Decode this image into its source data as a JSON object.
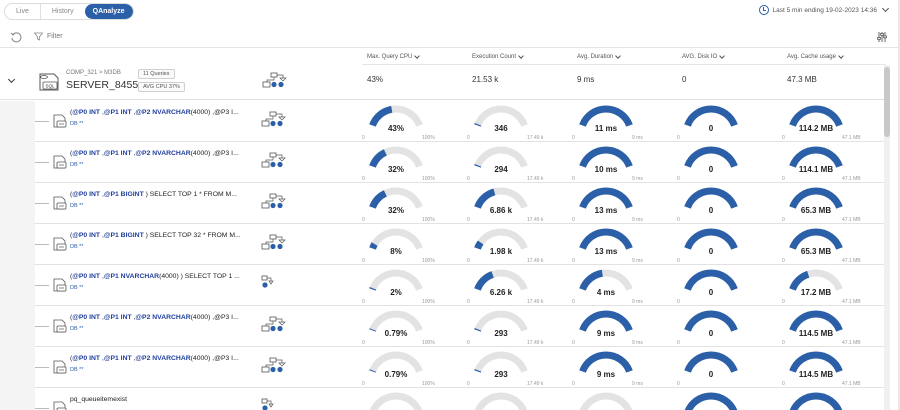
{
  "tabs": [
    {
      "label": "Live"
    },
    {
      "label": "History"
    },
    {
      "label": "QAnalyze",
      "active": true
    }
  ],
  "time_range": "Last 5 min ending  19-02-2023 14:36",
  "toolbar": {
    "filter_label": "Filter"
  },
  "columns": [
    {
      "label": "Max. Query CPU"
    },
    {
      "label": "Execution Count"
    },
    {
      "label": "Avg. Duration"
    },
    {
      "label": "AVG. Disk IO"
    },
    {
      "label": "Avg. Cache usage"
    }
  ],
  "server": {
    "path": "COMP_321 > M3DB",
    "name": "SERVER_8455",
    "queries_pill": "11 Queries",
    "cpu_pill": "AVG CPU 37%",
    "cpu": "43%",
    "exec": "21.53 k",
    "duration": "9 ms",
    "disk": "0",
    "cache": "47.3 MB"
  },
  "rows": [
    {
      "parts": [
        [
          "(",
          false
        ],
        [
          "@P0",
          true
        ],
        [
          " INT",
          true
        ],
        [
          " ,",
          false
        ],
        [
          "@P1",
          true
        ],
        [
          " INT",
          true
        ],
        [
          " ,",
          false
        ],
        [
          "@P2",
          true
        ],
        [
          " NVARCHAR",
          true
        ],
        [
          "(4000) ,@P3 I...",
          false
        ]
      ],
      "db": "DB **",
      "plan": "full",
      "gauges": [
        {
          "value": "43%",
          "fraction": 0.43,
          "max": "100%"
        },
        {
          "value": "346",
          "fraction": 0.02,
          "max": "17.49 k"
        },
        {
          "value": "11 ms",
          "fraction": 1.0,
          "max": "9 ms"
        },
        {
          "value": "0",
          "fraction": 1.0,
          "max": ""
        },
        {
          "value": "114.2 MB",
          "fraction": 1.0,
          "max": "47.1 MB"
        }
      ]
    },
    {
      "parts": [
        [
          "(",
          false
        ],
        [
          "@P0",
          true
        ],
        [
          " INT",
          true
        ],
        [
          " ,",
          false
        ],
        [
          "@P1",
          true
        ],
        [
          " INT",
          true
        ],
        [
          " ,",
          false
        ],
        [
          "@P2",
          true
        ],
        [
          " NVARCHAR",
          true
        ],
        [
          "(4000) ,@P3 I...",
          false
        ]
      ],
      "db": "DB **",
      "plan": "full",
      "gauges": [
        {
          "value": "32%",
          "fraction": 0.32,
          "max": "100%"
        },
        {
          "value": "294",
          "fraction": 0.02,
          "max": "17.49 k"
        },
        {
          "value": "10 ms",
          "fraction": 1.0,
          "max": "9 ms"
        },
        {
          "value": "0",
          "fraction": 1.0,
          "max": ""
        },
        {
          "value": "114.1 MB",
          "fraction": 1.0,
          "max": "47.1 MB"
        }
      ]
    },
    {
      "parts": [
        [
          "(",
          false
        ],
        [
          "@P0",
          true
        ],
        [
          " INT",
          true
        ],
        [
          " ,",
          false
        ],
        [
          "@P1",
          true
        ],
        [
          " BIGINT",
          true
        ],
        [
          " ) SELECT TOP 1 * FROM M...",
          false
        ]
      ],
      "db": "DB **",
      "plan": "full",
      "gauges": [
        {
          "value": "32%",
          "fraction": 0.32,
          "max": "100%"
        },
        {
          "value": "6.86 k",
          "fraction": 0.39,
          "max": "17.49 k"
        },
        {
          "value": "13 ms",
          "fraction": 1.0,
          "max": "9 ms"
        },
        {
          "value": "0",
          "fraction": 1.0,
          "max": ""
        },
        {
          "value": "65.3 MB",
          "fraction": 1.0,
          "max": "47.1 MB"
        }
      ]
    },
    {
      "parts": [
        [
          "(",
          false
        ],
        [
          "@P0",
          true
        ],
        [
          " INT",
          true
        ],
        [
          " ,",
          false
        ],
        [
          "@P1",
          true
        ],
        [
          " BIGINT",
          true
        ],
        [
          " ) SELECT TOP 32 * FROM M...",
          false
        ]
      ],
      "db": "DB **",
      "plan": "full",
      "gauges": [
        {
          "value": "8%",
          "fraction": 0.08,
          "max": "100%"
        },
        {
          "value": "1.98 k",
          "fraction": 0.11,
          "max": "17.49 k"
        },
        {
          "value": "13 ms",
          "fraction": 1.0,
          "max": "9 ms"
        },
        {
          "value": "0",
          "fraction": 1.0,
          "max": ""
        },
        {
          "value": "65.3 MB",
          "fraction": 1.0,
          "max": "47.1 MB"
        }
      ]
    },
    {
      "parts": [
        [
          "(",
          false
        ],
        [
          "@P0",
          true
        ],
        [
          " INT",
          true
        ],
        [
          " ,",
          false
        ],
        [
          "@P1",
          true
        ],
        [
          " NVARCHAR",
          true
        ],
        [
          "(4000) ) SELECT TOP 1 ...",
          false
        ]
      ],
      "db": "DB **",
      "plan": "small",
      "gauges": [
        {
          "value": "2%",
          "fraction": 0.02,
          "max": "100%"
        },
        {
          "value": "6.26 k",
          "fraction": 0.36,
          "max": "17.49 k"
        },
        {
          "value": "4 ms",
          "fraction": 0.44,
          "max": "9 ms"
        },
        {
          "value": "0",
          "fraction": 1.0,
          "max": ""
        },
        {
          "value": "17.2 MB",
          "fraction": 0.37,
          "max": "47.1 MB"
        }
      ]
    },
    {
      "parts": [
        [
          "(",
          false
        ],
        [
          "@P0",
          true
        ],
        [
          " INT",
          true
        ],
        [
          " ,",
          false
        ],
        [
          "@P1",
          true
        ],
        [
          " INT",
          true
        ],
        [
          " ,",
          false
        ],
        [
          "@P2",
          true
        ],
        [
          " NVARCHAR",
          true
        ],
        [
          "(4000) ,@P3 I...",
          false
        ]
      ],
      "db": "DB **",
      "plan": "full",
      "gauges": [
        {
          "value": "0.79%",
          "fraction": 0.008,
          "max": "100%"
        },
        {
          "value": "293",
          "fraction": 0.02,
          "max": "17.49 k"
        },
        {
          "value": "9 ms",
          "fraction": 1.0,
          "max": "9 ms"
        },
        {
          "value": "0",
          "fraction": 1.0,
          "max": ""
        },
        {
          "value": "114.5 MB",
          "fraction": 1.0,
          "max": "47.1 MB"
        }
      ]
    },
    {
      "parts": [
        [
          "(",
          false
        ],
        [
          "@P0",
          true
        ],
        [
          " INT",
          true
        ],
        [
          " ,",
          false
        ],
        [
          "@P1",
          true
        ],
        [
          " INT",
          true
        ],
        [
          " ,",
          false
        ],
        [
          "@P2",
          true
        ],
        [
          " NVARCHAR",
          true
        ],
        [
          "(4000) ,@P3 I...",
          false
        ]
      ],
      "db": "DB **",
      "plan": "full",
      "gauges": [
        {
          "value": "0.79%",
          "fraction": 0.008,
          "max": "100%"
        },
        {
          "value": "293",
          "fraction": 0.02,
          "max": "17.49 k"
        },
        {
          "value": "9 ms",
          "fraction": 1.0,
          "max": "9 ms"
        },
        {
          "value": "0",
          "fraction": 1.0,
          "max": ""
        },
        {
          "value": "114.5 MB",
          "fraction": 1.0,
          "max": "47.1 MB"
        }
      ]
    },
    {
      "parts": [
        [
          "pq_queueitemexist",
          false
        ]
      ],
      "db": "",
      "plan": "small",
      "gauges": [
        {
          "value": "",
          "fraction": 0,
          "max": ""
        },
        {
          "value": "",
          "fraction": 0,
          "max": ""
        },
        {
          "value": "",
          "fraction": 0,
          "max": ""
        },
        {
          "value": "",
          "fraction": 1.0,
          "max": ""
        },
        {
          "value": "",
          "fraction": 1.0,
          "max": ""
        }
      ]
    }
  ],
  "colors": {
    "accent": "#2b5fa8",
    "track": "#e3e3e3",
    "keyword": "#1f3e9b"
  }
}
